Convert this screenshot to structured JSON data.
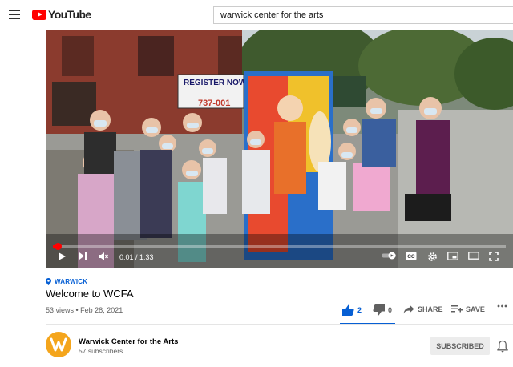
{
  "header": {
    "logo_text": "YouTube",
    "search_value": "warwick center for the arts"
  },
  "player": {
    "current_time": "0:01",
    "duration": "1:33",
    "progress_fraction": 0.011,
    "scene_sign_text": "REGISTER NOW SUMMER ART",
    "scene_sign_phone": "737-001"
  },
  "video": {
    "location": "WARWICK",
    "title": "Welcome to WCFA",
    "views": "53 views",
    "date": "Feb 28, 2021",
    "meta_separator": " • "
  },
  "actions": {
    "like_count": "2",
    "dislike_count": "0",
    "share_label": "SHARE",
    "save_label": "SAVE"
  },
  "channel": {
    "name": "Warwick Center for the Arts",
    "subscribers": "57 subscribers",
    "subscribe_label": "SUBSCRIBED",
    "avatar_color": "#f4a51c"
  },
  "colors": {
    "brand_red": "#ff0000",
    "link_blue": "#065fd4"
  }
}
